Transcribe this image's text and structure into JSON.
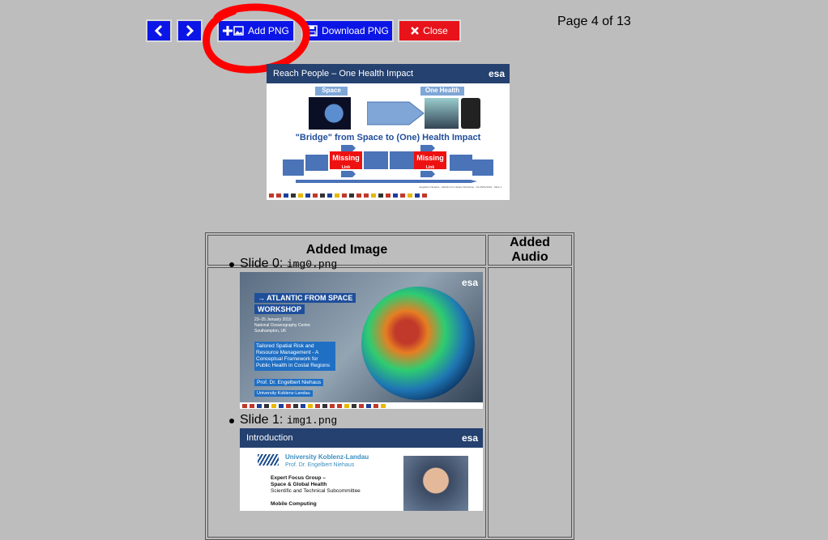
{
  "toolbar": {
    "prev_icon": "chevron-left-icon",
    "next_icon": "chevron-right-icon",
    "add_png_label": "Add PNG",
    "download_png_label": "Download PNG",
    "close_label": "Close"
  },
  "page_indicator": "Page 4 of 13",
  "current_slide": {
    "header": "Reach People – One Health Impact",
    "logo": "esa",
    "space_label": "Space",
    "one_health_label": "One Health",
    "bridge_text": "\"Bridge\" from Space to (One) Health Impact",
    "missing_label": "Missing",
    "link_label": "Link",
    "footer": "Engelbert Niehaus - Atlantic from Space Workshop - 23-25/01/2019 - Slide 4"
  },
  "table": {
    "col_image": "Added Image",
    "col_audio": "Added Audio",
    "items": [
      {
        "prefix": "Slide 0: ",
        "file": "img0.png"
      },
      {
        "prefix": "Slide 1: ",
        "file": "img1.png"
      }
    ]
  },
  "slide0": {
    "logo": "esa",
    "title_line1": "→ ATLANTIC FROM SPACE",
    "title_line2": "WORKSHOP",
    "date": "23–25 January 2019",
    "venue": "National Oceanography Centre",
    "city": "Southampton, UK",
    "talk": "Tailored Spatial Risk and Resource Management - A Conceptual Framework for Public Health in Costal Regions",
    "speaker": "Prof. Dr. Engelbert Niehaus",
    "affiliation": "University Koblenz-Landau"
  },
  "slide1": {
    "header": "Introduction",
    "logo": "esa",
    "university": "University Koblenz-Landau",
    "prof": "Prof. Dr. Engelbert Niehaus",
    "group1": "Expert Focus Group –",
    "group2": "Space & Global Health",
    "group3": "Scientific and Technical Subcommittee",
    "mobile": "Mobile Computing"
  }
}
